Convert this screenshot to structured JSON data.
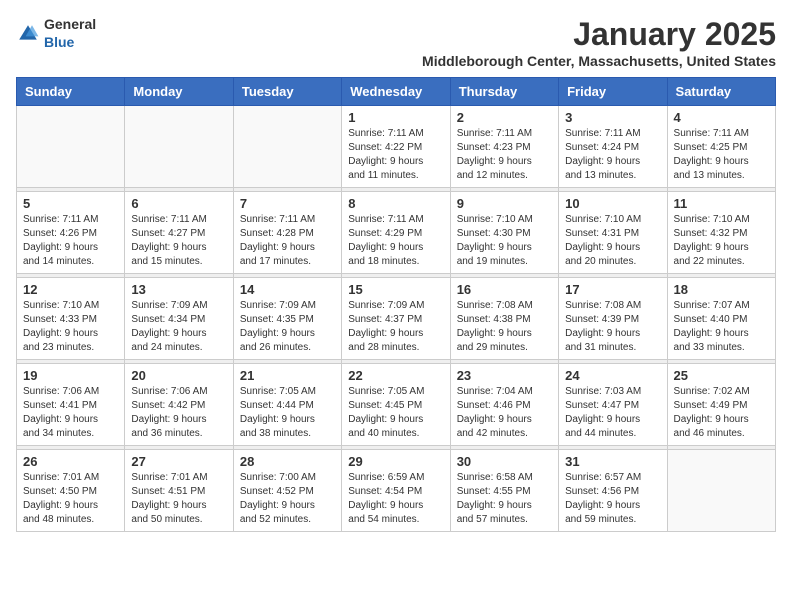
{
  "header": {
    "logo_general": "General",
    "logo_blue": "Blue",
    "month": "January 2025",
    "location": "Middleborough Center, Massachusetts, United States"
  },
  "days_of_week": [
    "Sunday",
    "Monday",
    "Tuesday",
    "Wednesday",
    "Thursday",
    "Friday",
    "Saturday"
  ],
  "weeks": [
    [
      {
        "day": "",
        "info": ""
      },
      {
        "day": "",
        "info": ""
      },
      {
        "day": "",
        "info": ""
      },
      {
        "day": "1",
        "info": "Sunrise: 7:11 AM\nSunset: 4:22 PM\nDaylight: 9 hours\nand 11 minutes."
      },
      {
        "day": "2",
        "info": "Sunrise: 7:11 AM\nSunset: 4:23 PM\nDaylight: 9 hours\nand 12 minutes."
      },
      {
        "day": "3",
        "info": "Sunrise: 7:11 AM\nSunset: 4:24 PM\nDaylight: 9 hours\nand 13 minutes."
      },
      {
        "day": "4",
        "info": "Sunrise: 7:11 AM\nSunset: 4:25 PM\nDaylight: 9 hours\nand 13 minutes."
      }
    ],
    [
      {
        "day": "5",
        "info": "Sunrise: 7:11 AM\nSunset: 4:26 PM\nDaylight: 9 hours\nand 14 minutes."
      },
      {
        "day": "6",
        "info": "Sunrise: 7:11 AM\nSunset: 4:27 PM\nDaylight: 9 hours\nand 15 minutes."
      },
      {
        "day": "7",
        "info": "Sunrise: 7:11 AM\nSunset: 4:28 PM\nDaylight: 9 hours\nand 17 minutes."
      },
      {
        "day": "8",
        "info": "Sunrise: 7:11 AM\nSunset: 4:29 PM\nDaylight: 9 hours\nand 18 minutes."
      },
      {
        "day": "9",
        "info": "Sunrise: 7:10 AM\nSunset: 4:30 PM\nDaylight: 9 hours\nand 19 minutes."
      },
      {
        "day": "10",
        "info": "Sunrise: 7:10 AM\nSunset: 4:31 PM\nDaylight: 9 hours\nand 20 minutes."
      },
      {
        "day": "11",
        "info": "Sunrise: 7:10 AM\nSunset: 4:32 PM\nDaylight: 9 hours\nand 22 minutes."
      }
    ],
    [
      {
        "day": "12",
        "info": "Sunrise: 7:10 AM\nSunset: 4:33 PM\nDaylight: 9 hours\nand 23 minutes."
      },
      {
        "day": "13",
        "info": "Sunrise: 7:09 AM\nSunset: 4:34 PM\nDaylight: 9 hours\nand 24 minutes."
      },
      {
        "day": "14",
        "info": "Sunrise: 7:09 AM\nSunset: 4:35 PM\nDaylight: 9 hours\nand 26 minutes."
      },
      {
        "day": "15",
        "info": "Sunrise: 7:09 AM\nSunset: 4:37 PM\nDaylight: 9 hours\nand 28 minutes."
      },
      {
        "day": "16",
        "info": "Sunrise: 7:08 AM\nSunset: 4:38 PM\nDaylight: 9 hours\nand 29 minutes."
      },
      {
        "day": "17",
        "info": "Sunrise: 7:08 AM\nSunset: 4:39 PM\nDaylight: 9 hours\nand 31 minutes."
      },
      {
        "day": "18",
        "info": "Sunrise: 7:07 AM\nSunset: 4:40 PM\nDaylight: 9 hours\nand 33 minutes."
      }
    ],
    [
      {
        "day": "19",
        "info": "Sunrise: 7:06 AM\nSunset: 4:41 PM\nDaylight: 9 hours\nand 34 minutes."
      },
      {
        "day": "20",
        "info": "Sunrise: 7:06 AM\nSunset: 4:42 PM\nDaylight: 9 hours\nand 36 minutes."
      },
      {
        "day": "21",
        "info": "Sunrise: 7:05 AM\nSunset: 4:44 PM\nDaylight: 9 hours\nand 38 minutes."
      },
      {
        "day": "22",
        "info": "Sunrise: 7:05 AM\nSunset: 4:45 PM\nDaylight: 9 hours\nand 40 minutes."
      },
      {
        "day": "23",
        "info": "Sunrise: 7:04 AM\nSunset: 4:46 PM\nDaylight: 9 hours\nand 42 minutes."
      },
      {
        "day": "24",
        "info": "Sunrise: 7:03 AM\nSunset: 4:47 PM\nDaylight: 9 hours\nand 44 minutes."
      },
      {
        "day": "25",
        "info": "Sunrise: 7:02 AM\nSunset: 4:49 PM\nDaylight: 9 hours\nand 46 minutes."
      }
    ],
    [
      {
        "day": "26",
        "info": "Sunrise: 7:01 AM\nSunset: 4:50 PM\nDaylight: 9 hours\nand 48 minutes."
      },
      {
        "day": "27",
        "info": "Sunrise: 7:01 AM\nSunset: 4:51 PM\nDaylight: 9 hours\nand 50 minutes."
      },
      {
        "day": "28",
        "info": "Sunrise: 7:00 AM\nSunset: 4:52 PM\nDaylight: 9 hours\nand 52 minutes."
      },
      {
        "day": "29",
        "info": "Sunrise: 6:59 AM\nSunset: 4:54 PM\nDaylight: 9 hours\nand 54 minutes."
      },
      {
        "day": "30",
        "info": "Sunrise: 6:58 AM\nSunset: 4:55 PM\nDaylight: 9 hours\nand 57 minutes."
      },
      {
        "day": "31",
        "info": "Sunrise: 6:57 AM\nSunset: 4:56 PM\nDaylight: 9 hours\nand 59 minutes."
      },
      {
        "day": "",
        "info": ""
      }
    ]
  ]
}
